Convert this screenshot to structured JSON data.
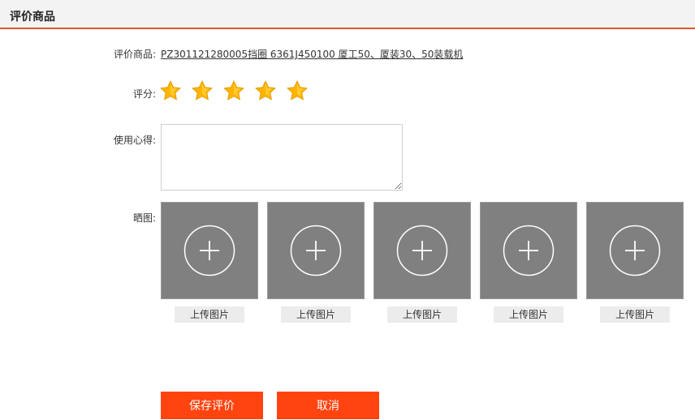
{
  "header": {
    "title": "评价商品"
  },
  "form": {
    "product_label": "评价商品:",
    "product_name": "PZ301121280005挡圈 6361J450100 厦工50、厦装30、50装载机",
    "rating_label": "评分:",
    "rating": {
      "value": 5,
      "max": 5,
      "star_color": "#ffb400"
    },
    "review_label": "使用心得:",
    "review_value": "",
    "photos_label": "晒图:",
    "photos": [
      {
        "upload_label": "上传图片"
      },
      {
        "upload_label": "上传图片"
      },
      {
        "upload_label": "上传图片"
      },
      {
        "upload_label": "上传图片"
      },
      {
        "upload_label": "上传图片"
      }
    ]
  },
  "actions": {
    "save_label": "保存评价",
    "cancel_label": "取消"
  },
  "colors": {
    "accent": "#ff4410",
    "header_border": "#e4572e",
    "upload_bg": "#808080"
  }
}
